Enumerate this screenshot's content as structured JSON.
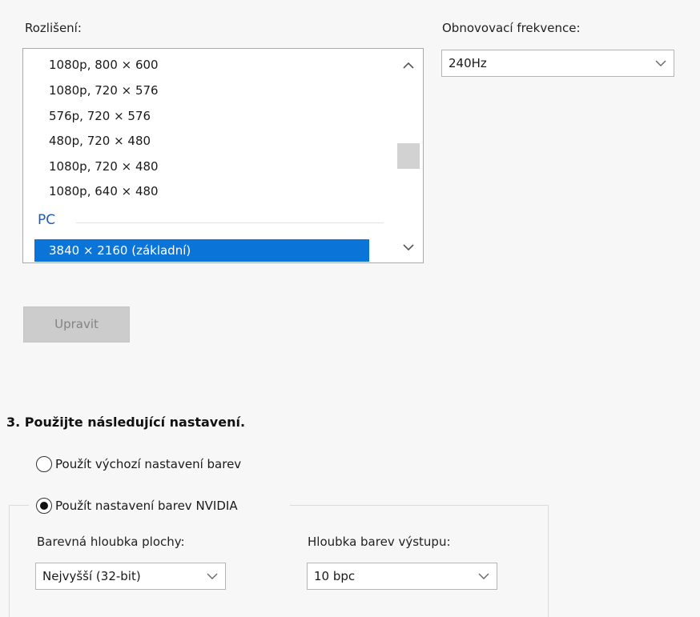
{
  "resolution": {
    "label": "Rozlišení:",
    "items": [
      "1080p, 800 × 600",
      "1080p, 720 × 576",
      "576p, 720 × 576",
      "480p, 720 × 480",
      "1080p, 720 × 480",
      "1080p, 640 × 480"
    ],
    "group_header": "PC",
    "selected_item": "3840 × 2160 (základní)"
  },
  "refresh_rate": {
    "label": "Obnovovací frekvence:",
    "value": "240Hz"
  },
  "edit_button": {
    "label": "Upravit"
  },
  "section3": {
    "title": "3. Použijte následující nastavení.",
    "radio_default": {
      "label": "Použít výchozí nastavení barev",
      "checked": false
    },
    "radio_nvidia": {
      "label": "Použít nastavení barev NVIDIA",
      "checked": true
    }
  },
  "desktop_color_depth": {
    "label": "Barevná hloubka plochy:",
    "value": "Nejvyšší (32-bit)"
  },
  "output_color_depth": {
    "label": "Hloubka barev výstupu:",
    "value": "10 bpc"
  }
}
